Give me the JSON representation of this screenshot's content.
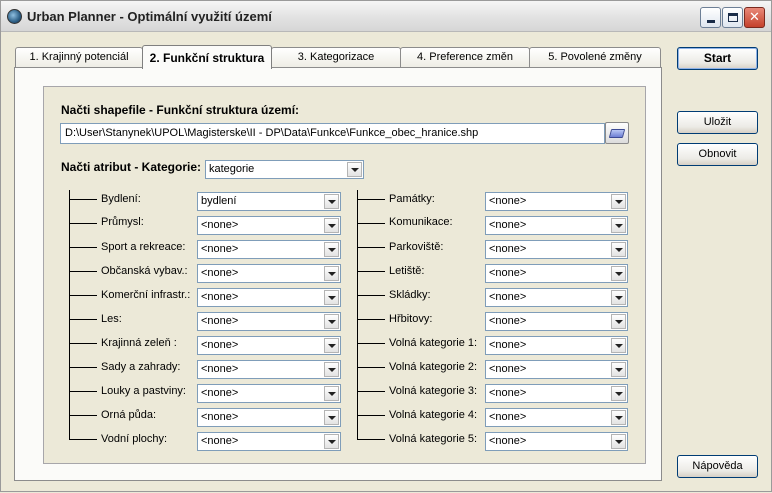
{
  "window": {
    "title": "Urban Planner - Optimální využití území"
  },
  "tabs": [
    {
      "label": "1. Krajinný potenciál"
    },
    {
      "label": "2. Funkční struktura"
    },
    {
      "label": "3. Kategorizace"
    },
    {
      "label": "4. Preference změn"
    },
    {
      "label": "5. Povolené změny"
    }
  ],
  "shapefile": {
    "label": "Načti shapefile - Funkční struktura území:",
    "path": "D:\\User\\Stanynek\\UPOL\\Magisterske\\II - DP\\Data\\Funkce\\Funkce_obec_hranice.shp"
  },
  "attribute": {
    "label": "Načti atribut  - Kategorie:",
    "value": "kategorie"
  },
  "left_column": [
    {
      "label": "Bydlení:",
      "value": "bydlení"
    },
    {
      "label": "Průmysl:",
      "value": "<none>"
    },
    {
      "label": "Sport a rekreace:",
      "value": "<none>"
    },
    {
      "label": "Občanská vybav.:",
      "value": "<none>"
    },
    {
      "label": "Komerční infrastr.:",
      "value": "<none>"
    },
    {
      "label": "Les:",
      "value": "<none>"
    },
    {
      "label": "Krajinná zeleň :",
      "value": "<none>"
    },
    {
      "label": "Sady a zahrady:",
      "value": "<none>"
    },
    {
      "label": "Louky a pastviny:",
      "value": "<none>"
    },
    {
      "label": "Orná půda:",
      "value": "<none>"
    },
    {
      "label": "Vodní plochy:",
      "value": "<none>"
    }
  ],
  "right_column": [
    {
      "label": "Památky:",
      "value": "<none>"
    },
    {
      "label": "Komunikace:",
      "value": "<none>"
    },
    {
      "label": "Parkoviště:",
      "value": "<none>"
    },
    {
      "label": "Letiště:",
      "value": "<none>"
    },
    {
      "label": "Skládky:",
      "value": "<none>"
    },
    {
      "label": "Hřbitovy:",
      "value": "<none>"
    },
    {
      "label": "Volná kategorie 1:",
      "value": "<none>"
    },
    {
      "label": "Volná kategorie 2:",
      "value": "<none>"
    },
    {
      "label": "Volná kategorie 3:",
      "value": "<none>"
    },
    {
      "label": "Volná kategorie 4:",
      "value": "<none>"
    },
    {
      "label": "Volná kategorie 5:",
      "value": "<none>"
    }
  ],
  "buttons": {
    "start": "Start",
    "save": "Uložit",
    "refresh": "Obnovit",
    "help": "Nápověda"
  },
  "icons": {
    "app": "globe-icon",
    "browse": "folder-open-icon"
  }
}
